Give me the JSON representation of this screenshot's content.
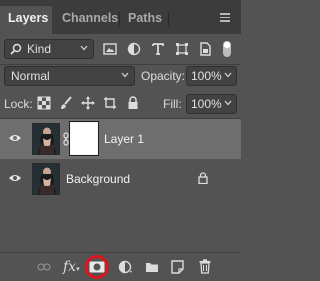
{
  "tabs": [
    {
      "label": "Layers",
      "active": true
    },
    {
      "label": "Channels",
      "active": false
    },
    {
      "label": "Paths",
      "active": false
    }
  ],
  "filter": {
    "kind_label": "Kind",
    "filter_icons": [
      "image-filter-icon",
      "adjustment-filter-icon",
      "type-filter-icon",
      "shape-filter-icon",
      "smart-object-filter-icon",
      "filter-toggle-icon"
    ]
  },
  "blend": {
    "mode": "Normal",
    "opacity_label": "Opacity:",
    "opacity_value": "100%"
  },
  "lock": {
    "label": "Lock:",
    "fill_label": "Fill:",
    "fill_value": "100%"
  },
  "layers": [
    {
      "name": "Layer 1",
      "selected": true,
      "has_mask": true
    },
    {
      "name": "Background",
      "selected": false,
      "locked": true
    }
  ],
  "toolbar_icons": [
    "link-layers-icon",
    "fx-icon",
    "add-mask-icon",
    "adjustment-layer-icon",
    "group-folder-icon",
    "new-layer-icon",
    "trash-icon"
  ],
  "colors": {
    "panel_bg": "#535353",
    "tab_bar_bg": "#3c3c3c",
    "selected_layer_bg": "#6e6e6e",
    "highlight_ring": "#e0141c"
  }
}
